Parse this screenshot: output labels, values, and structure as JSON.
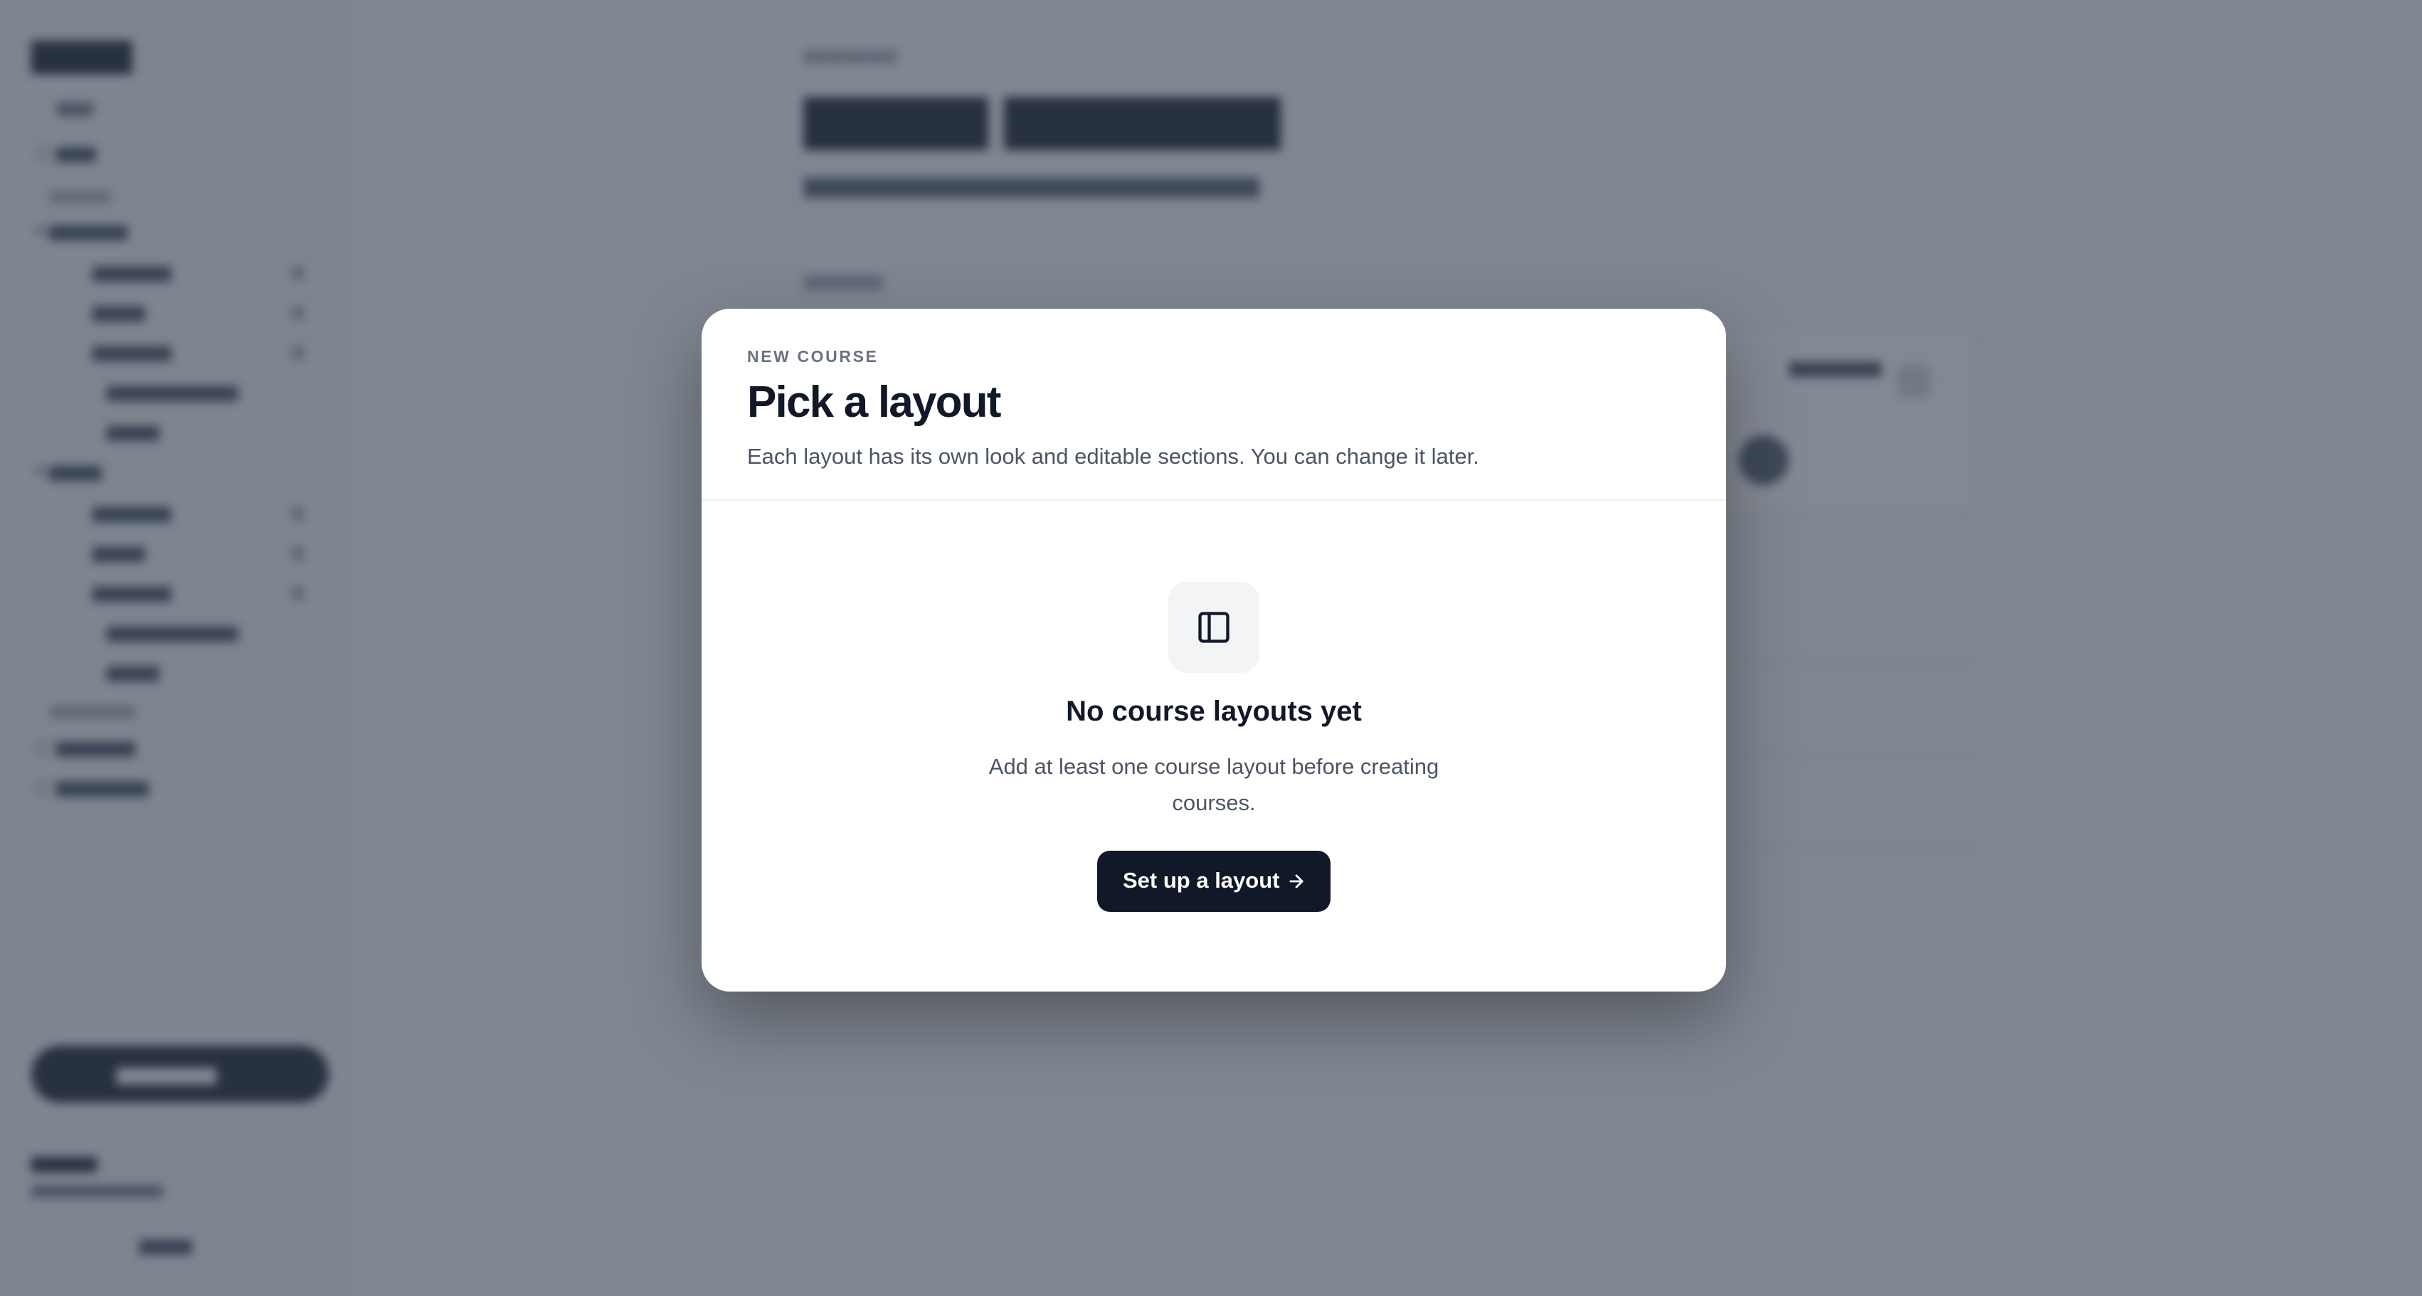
{
  "modal": {
    "eyebrow": "NEW COURSE",
    "title": "Pick a layout",
    "description": "Each layout has its own look and editable sections. You can change it later.",
    "empty_state": {
      "icon": "sidebar-layout-icon",
      "title": "No course layouts yet",
      "description": "Add at least one course layout before creating courses.",
      "button_label": "Set up a layout",
      "button_icon": "arrow-right-icon"
    }
  },
  "colors": {
    "primary": "#111827",
    "overlay": "#374151",
    "muted_text": "#6b7280",
    "body_text": "#4b5563",
    "icon_bg": "#f3f4f6"
  }
}
